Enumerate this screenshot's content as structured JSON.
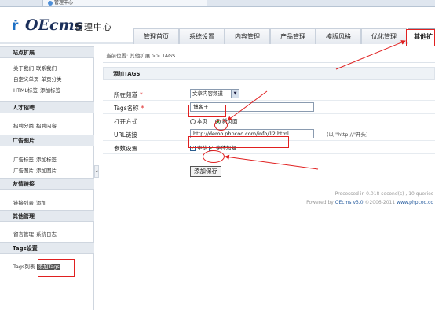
{
  "browser": {
    "tab1": "",
    "tab2": "管理中心"
  },
  "header": {
    "logo_text": "OEcms",
    "logo_sub": "管理中心",
    "nav": [
      "管理首页",
      "系统设置",
      "内容管理",
      "产品管理",
      "模版风格",
      "优化管理",
      "其他扩"
    ]
  },
  "sidebar": {
    "sections": [
      {
        "title": "站点扩展",
        "rows": [
          [
            "关于我们",
            "联系我们"
          ],
          [
            "自定义单页",
            "单页分类"
          ],
          [
            "HTML标签",
            "添加标签"
          ]
        ]
      },
      {
        "title": "人才招聘",
        "rows": [
          [
            "招聘分类",
            "招聘内容"
          ]
        ]
      },
      {
        "title": "广告图片",
        "rows": [
          [
            "广告标签",
            "添加标签"
          ],
          [
            "广告图片",
            "添加图片"
          ]
        ]
      },
      {
        "title": "友情链接",
        "rows": [
          [
            "链接列表",
            "添加"
          ]
        ]
      },
      {
        "title": "其他管理",
        "rows": [
          [
            "留言管理",
            "系统日志"
          ]
        ]
      },
      {
        "title": "Tags设置",
        "rows": [
          [
            "Tags列表",
            "添加Tags"
          ]
        ]
      }
    ]
  },
  "main": {
    "breadcrumb": "当前位置: 其他扩展 >> TAGS",
    "section_title": "添加TAGS",
    "form": {
      "channel_label": "所在频道",
      "channel_value": "文章内容频道",
      "tags_label": "Tags名称",
      "tags_value": "博客王",
      "open_label": "打开方式",
      "open_opt1": "本页",
      "open_opt2": "新页面",
      "url_label": "URL链接",
      "url_value": "http://demo.phpcoo.com/info/12.html",
      "url_hint": "(以 \"http://\"开头)",
      "params_label": "参数设置",
      "param1": "审核",
      "param2": "字体加粗",
      "save_label": "添加保存",
      "required_mark": "*"
    },
    "footer_line1": "Processed in 0.018 second(s) , 10 queries",
    "footer_line2_prefix": "Powered by ",
    "footer_brand": "OEcms v3.0",
    "footer_line2_mid": " ©2006-2011 ",
    "footer_link": "www.phpcoo.co"
  },
  "colors": {
    "annotation": "#e02020",
    "brand": "#1b2f5a",
    "link": "#2a5fa0"
  }
}
